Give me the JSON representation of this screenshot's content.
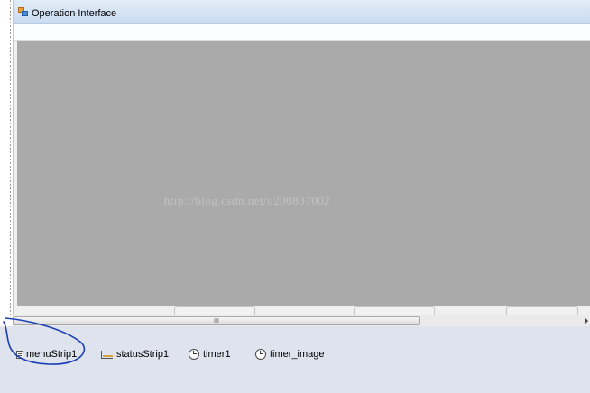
{
  "form": {
    "title": "Operation Interface",
    "watermark": "http://blog.csdn.net/u200807002"
  },
  "scrollbar": {
    "grip": "III"
  },
  "component_tray": {
    "items": [
      {
        "label": "menuStrip1",
        "icon": "menustrip-icon"
      },
      {
        "label": "statusStrip1",
        "icon": "statusstrip-icon"
      },
      {
        "label": "timer1",
        "icon": "timer-icon"
      },
      {
        "label": "timer_image",
        "icon": "timer-icon"
      }
    ]
  },
  "colors": {
    "client_area": "#aaaaaa",
    "titlebar": "#d3e2f4",
    "tray_background": "#dfe3ee",
    "annotation_ink": "#1a3fb5"
  }
}
